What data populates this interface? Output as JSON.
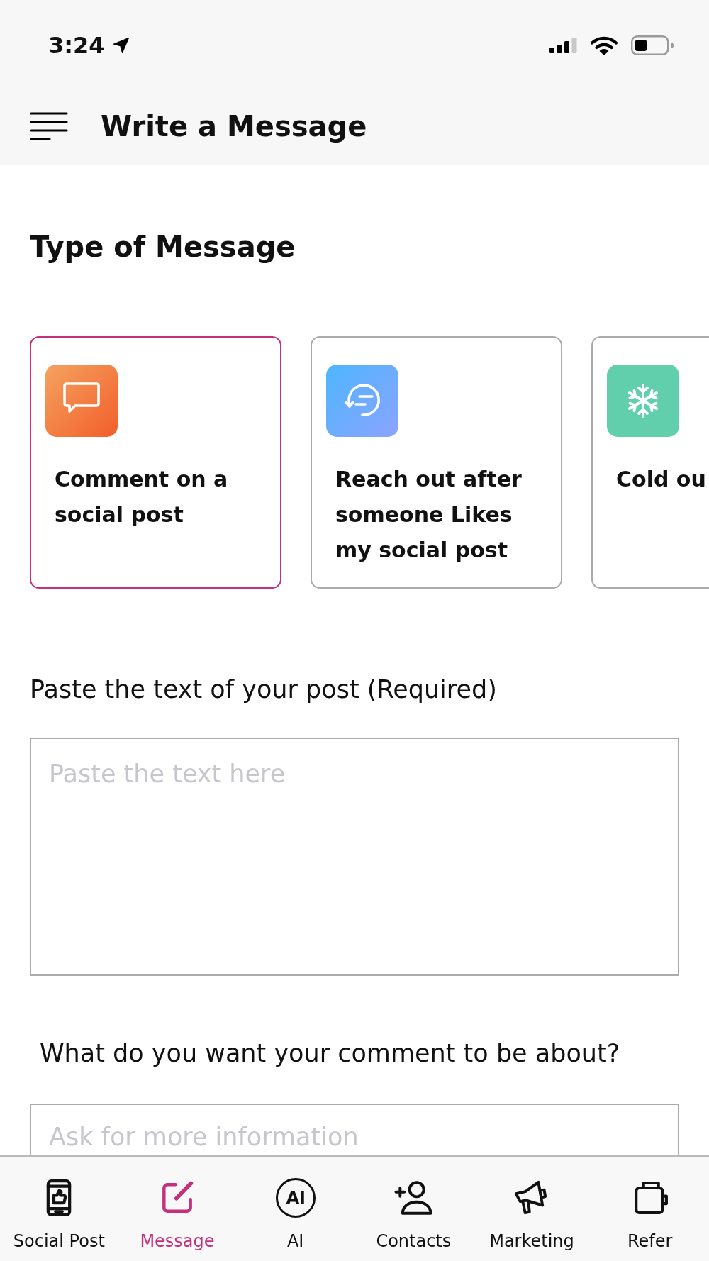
{
  "status_bar": {
    "time": "3:24"
  },
  "header": {
    "title": "Write a Message"
  },
  "section_title": "Type of Message",
  "message_types": [
    {
      "label": "Comment on a social post",
      "selected": true
    },
    {
      "label": "Reach out after someone Likes my social post",
      "selected": false
    },
    {
      "label": "Cold ou",
      "selected": false
    }
  ],
  "fields": [
    {
      "label": "Paste the text of your post (Required)",
      "placeholder": "Paste the text here"
    },
    {
      "label": "What do you want your comment to be about?",
      "placeholder": "Ask for more information"
    }
  ],
  "tab_bar": [
    {
      "label": "Social Post",
      "selected": false
    },
    {
      "label": "Message",
      "selected": true
    },
    {
      "label": "AI",
      "icon_text": "AI",
      "selected": false
    },
    {
      "label": "Contacts",
      "selected": false
    },
    {
      "label": "Marketing",
      "selected": false
    },
    {
      "label": "Refer",
      "selected": false
    }
  ]
}
